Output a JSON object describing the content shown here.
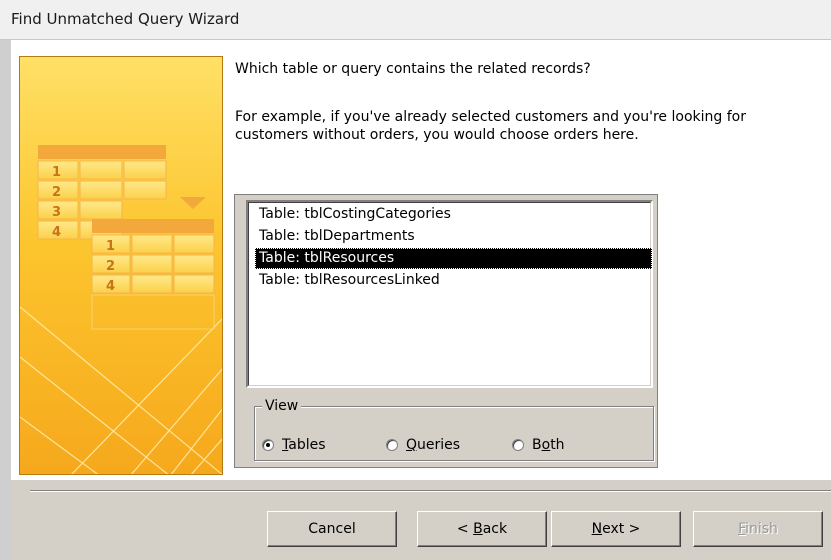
{
  "window": {
    "title": "Find Unmatched Query Wizard"
  },
  "prompt": {
    "question": "Which table or query contains the related records?",
    "example": "For example, if you've already selected customers and you're looking for customers without orders, you would choose orders here."
  },
  "illustration": {
    "back_table_numbers": [
      "1",
      "2",
      "3",
      "4"
    ],
    "front_table_numbers": [
      "1",
      "2",
      "4"
    ]
  },
  "list": {
    "items": [
      {
        "label": "Table: tblCostingCategories",
        "selected": false
      },
      {
        "label": "Table: tblDepartments",
        "selected": false
      },
      {
        "label": "Table: tblResources",
        "selected": true
      },
      {
        "label": "Table: tblResourcesLinked",
        "selected": false
      }
    ]
  },
  "view": {
    "legend": "View",
    "options": [
      {
        "prefix": "",
        "accel": "T",
        "rest": "ables",
        "checked": true
      },
      {
        "prefix": "",
        "accel": "Q",
        "rest": "ueries",
        "checked": false
      },
      {
        "prefix": "B",
        "accel": "o",
        "rest": "th",
        "checked": false
      }
    ]
  },
  "buttons": {
    "cancel": "Cancel",
    "back": {
      "prefix": "< ",
      "accel": "B",
      "rest": "ack"
    },
    "next": {
      "prefix": "",
      "accel": "N",
      "rest": "ext >"
    },
    "finish": {
      "prefix": "",
      "accel": "F",
      "rest": "inish",
      "enabled": false
    }
  },
  "colors": {
    "illustration_yellow": "#fcc52e",
    "dialog_face": "#d4d0c8",
    "selection": "#000000"
  }
}
